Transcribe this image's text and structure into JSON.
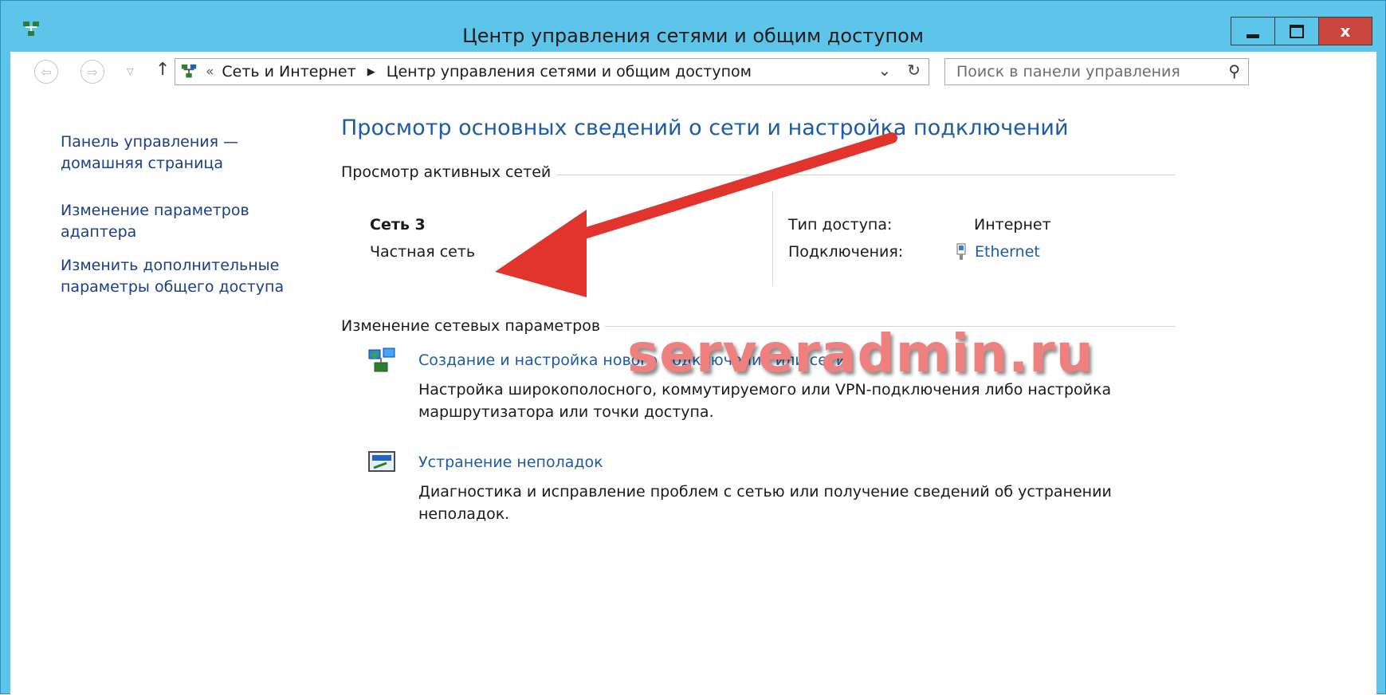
{
  "window": {
    "title": "Центр управления сетями и общим доступом",
    "accent_color": "#5ec5ea",
    "close_label": "x"
  },
  "nav": {
    "back_icon": "back-arrow-icon",
    "forward_icon": "forward-arrow-icon",
    "up_icon": "up-arrow-icon",
    "breadcrumb_chevron": "«",
    "breadcrumb": [
      "Сеть и Интернет",
      "Центр управления сетями и общим доступом"
    ],
    "search_placeholder": "Поиск в панели управления"
  },
  "sidebar": {
    "items": [
      {
        "label_line1": "Панель управления —",
        "label_line2": "домашняя страница"
      },
      {
        "label_line1": "Изменение параметров",
        "label_line2": "адаптера"
      },
      {
        "label_line1": "Изменить дополнительные",
        "label_line2": "параметры общего доступа"
      }
    ]
  },
  "main": {
    "heading": "Просмотр основных сведений о сети и настройка подключений",
    "active_networks_title": "Просмотр активных сетей",
    "network": {
      "name": "Сеть  3",
      "type": "Частная сеть",
      "access_label": "Тип доступа:",
      "access_value": "Интернет",
      "connections_label": "Подключения:",
      "connection_value": "Ethernet"
    },
    "change_settings_title": "Изменение сетевых параметров",
    "tasks": [
      {
        "icon": "network-setup-icon",
        "link": "Создание и настройка нового подключения или сети",
        "desc_line1": "Настройка широкополосного, коммутируемого или VPN-подключения либо настройка",
        "desc_line2": "маршрутизатора или точки доступа."
      },
      {
        "icon": "troubleshoot-icon",
        "link": "Устранение неполадок",
        "desc_line1": "Диагностика и исправление проблем с сетью или получение сведений об устранении",
        "desc_line2": "неполадок."
      }
    ]
  },
  "watermark": "serveradmin.ru",
  "annotation_arrow_color": "#e0342c"
}
